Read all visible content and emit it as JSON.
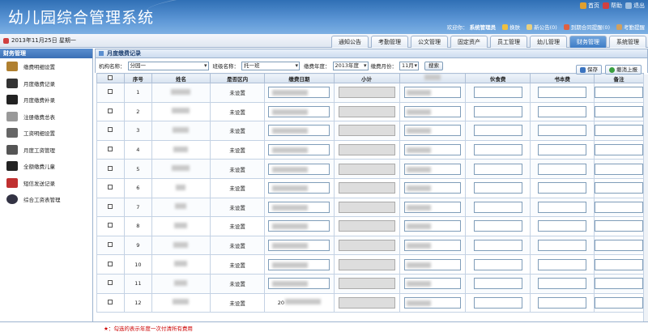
{
  "app": {
    "title": "幼儿园综合管理系统"
  },
  "toplinks": [
    {
      "label": "首页",
      "color": "#e0a030"
    },
    {
      "label": "帮助",
      "color": "#d04040"
    },
    {
      "label": "退出",
      "color": "#a0c0e0"
    }
  ],
  "userbar": {
    "welcome": "欢迎你：",
    "user": "系统管理员",
    "items": [
      {
        "label": "换肤"
      },
      {
        "label": "新公告(0)"
      },
      {
        "label": "到期合同提醒(0)"
      },
      {
        "label": "考勤提醒"
      }
    ]
  },
  "date": "2013年11月25日 星期一",
  "tabs": [
    {
      "label": "通知公告"
    },
    {
      "label": "考勤管理"
    },
    {
      "label": "公文管理"
    },
    {
      "label": "固定资产"
    },
    {
      "label": "员工管理"
    },
    {
      "label": "幼儿管理"
    },
    {
      "label": "财务管理",
      "active": true
    },
    {
      "label": "系统管理"
    }
  ],
  "sidebar": {
    "header": "财务管理",
    "items": [
      {
        "label": "缴费明细设置",
        "icon": "coins-icon"
      },
      {
        "label": "月度缴费记录",
        "icon": "person-money-icon"
      },
      {
        "label": "月度缴费补录",
        "icon": "wallet-icon"
      },
      {
        "label": "注册缴费总表",
        "icon": "register-icon"
      },
      {
        "label": "工资明细设置",
        "icon": "box-icon"
      },
      {
        "label": "月度工资管理",
        "icon": "box-icon"
      },
      {
        "label": "全额缴费儿童",
        "icon": "wallet-icon"
      },
      {
        "label": "短信发送记录",
        "icon": "sms-icon"
      },
      {
        "label": "综合工资表管理",
        "icon": "person-icon"
      }
    ]
  },
  "main": {
    "title": "月度缴费记录",
    "filters": {
      "org_label": "机构名称：",
      "org_value": "分园一",
      "class_label": "班级名称：",
      "class_value": "托一班",
      "year_label": "缴费年度：",
      "year_value": "2013年度",
      "month_label": "缴费月份：",
      "month_value": "11月",
      "search": "搜索"
    },
    "actions": {
      "save": "保存",
      "report": "撤消上报"
    },
    "columns": [
      "",
      "序号",
      "姓名",
      "是否区内",
      "缴费日期",
      "小计",
      "",
      "伙食费",
      "书本费",
      "备注"
    ],
    "rows": [
      {
        "no": "1",
        "status": "未设置"
      },
      {
        "no": "2",
        "status": "未设置"
      },
      {
        "no": "3",
        "status": "未设置"
      },
      {
        "no": "4",
        "status": "未设置"
      },
      {
        "no": "5",
        "status": "未设置"
      },
      {
        "no": "6",
        "status": "未设置"
      },
      {
        "no": "7",
        "status": "未设置"
      },
      {
        "no": "8",
        "status": "未设置"
      },
      {
        "no": "9",
        "status": "未设置"
      },
      {
        "no": "10",
        "status": "未设置"
      },
      {
        "no": "11",
        "status": "未设置"
      },
      {
        "no": "12",
        "status": "未设置",
        "date_prefix": "20"
      }
    ]
  },
  "footer": "★：勾选的表示年度一次付清所有费用"
}
